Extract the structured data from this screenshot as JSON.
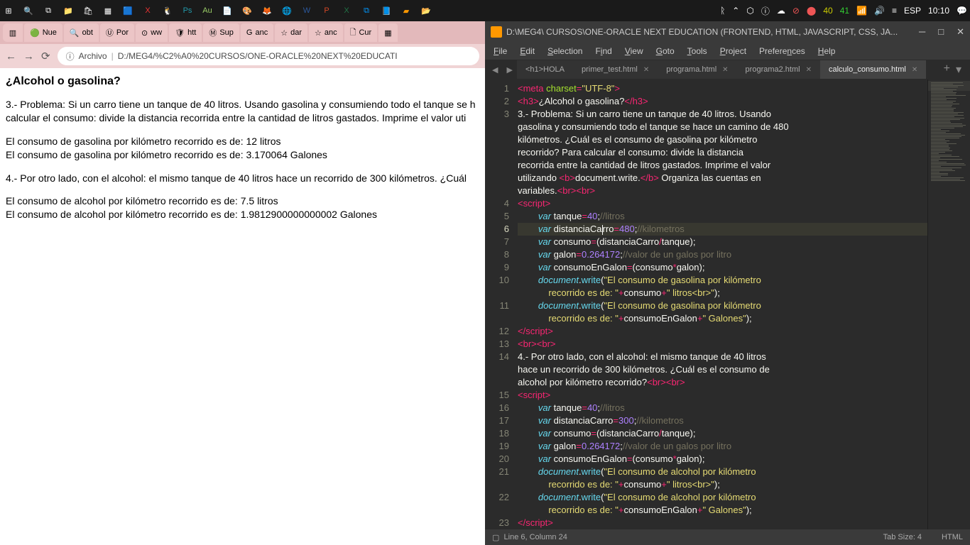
{
  "taskbar": {
    "right": {
      "n1": "40",
      "n2": "41",
      "lang": "ESP",
      "time": "10:10"
    }
  },
  "browser": {
    "tabs": [
      "Nue",
      "obt",
      "Por",
      "ww",
      "htt",
      "Sup",
      "anc",
      "dar",
      "anc",
      "Cur"
    ],
    "addr_label": "Archivo",
    "addr_path": "D:/MEG4/%C2%A0%20CURSOS/ONE-ORACLE%20NEXT%20EDUCATI",
    "page": {
      "h": "¿Alcohol o gasolina?",
      "p1": "3.- Problema: Si un carro tiene un tanque de 40 litros. Usando gasolina y consumiendo todo el tanque se h calcular el consumo: divide la distancia recorrida entre la cantidad de litros gastados. Imprime el valor uti",
      "l1": "El consumo de gasolina por kilómetro recorrido es de: 12 litros",
      "l2": "El consumo de gasolina por kilómetro recorrido es de: 3.170064 Galones",
      "p2": "4.- Por otro lado, con el alcohol: el mismo tanque de 40 litros hace un recorrido de 300 kilómetros. ¿Cuál",
      "l3": "El consumo de alcohol por kilómetro recorrido es de: 7.5 litros",
      "l4": "El consumo de alcohol por kilómetro recorrido es de: 1.9812900000000002 Galones"
    }
  },
  "editor": {
    "title": "D:\\MEG4\\  CURSOS\\ONE-ORACLE NEXT EDUCATION (FRONTEND, HTML, JAVASCRIPT, CSS, JA...",
    "menu": [
      "File",
      "Edit",
      "Selection",
      "Find",
      "View",
      "Goto",
      "Tools",
      "Project",
      "Preferences",
      "Help"
    ],
    "tabs": [
      {
        "label": "<h1>HOLA",
        "close": false
      },
      {
        "label": "primer_test.html",
        "close": true
      },
      {
        "label": "programa.html",
        "close": true
      },
      {
        "label": "programa2.html",
        "close": true
      },
      {
        "label": "calculo_consumo.html",
        "close": true,
        "active": true
      }
    ],
    "status": {
      "left": "Line 6, Column 24",
      "tab": "Tab Size: 4",
      "lang": "HTML"
    },
    "gutters": [
      "1",
      "2",
      "3",
      "",
      "",
      "",
      "",
      "",
      "",
      "4",
      "5",
      "6",
      "7",
      "8",
      "9",
      "10",
      "",
      "11",
      "",
      "12",
      "13",
      "14",
      "",
      "",
      "15",
      "16",
      "17",
      "18",
      "19",
      "20",
      "21",
      "",
      "22",
      "",
      "23"
    ]
  }
}
